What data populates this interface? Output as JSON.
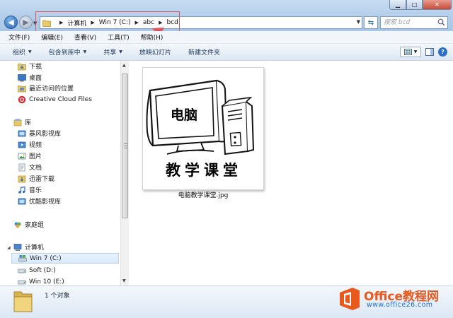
{
  "address_bar": {
    "crumbs": [
      "计算机",
      "Win 7 (C:)",
      "abc",
      "bcd"
    ]
  },
  "search": {
    "placeholder": "搜索 bcd"
  },
  "menu": [
    "文件(F)",
    "编辑(E)",
    "查看(V)",
    "工具(T)",
    "帮助(H)"
  ],
  "toolbar": {
    "organize": "组织",
    "include_library": "包含到库中",
    "share": "共享",
    "slideshow": "放映幻灯片",
    "new_folder": "新建文件夹"
  },
  "nav": {
    "favorites": [
      "下载",
      "桌面",
      "最近访问的位置",
      "Creative Cloud Files"
    ],
    "library_header": "库",
    "libraries": [
      "暴风影视库",
      "视频",
      "图片",
      "文档",
      "迅雷下载",
      "音乐",
      "优酷影视库"
    ],
    "homegroup": "家庭组",
    "computer_header": "计算机",
    "drives": [
      "Win 7 (C:)",
      "Soft (D:)",
      "Win 10 (E:)"
    ]
  },
  "file": {
    "name": "电脑教学课堂.jpg",
    "thumbnail_line1": "电脑",
    "thumbnail_line2": "教学课堂"
  },
  "details": {
    "count": "1 个对象"
  },
  "watermark": {
    "brand": "Office教程网",
    "url": "www.office26.com"
  },
  "colors": {
    "annotation": "#e0555e",
    "logo_orange": "#e9591e",
    "logo_blue": "#1e6fc5",
    "selection": "#d9e9fb"
  }
}
